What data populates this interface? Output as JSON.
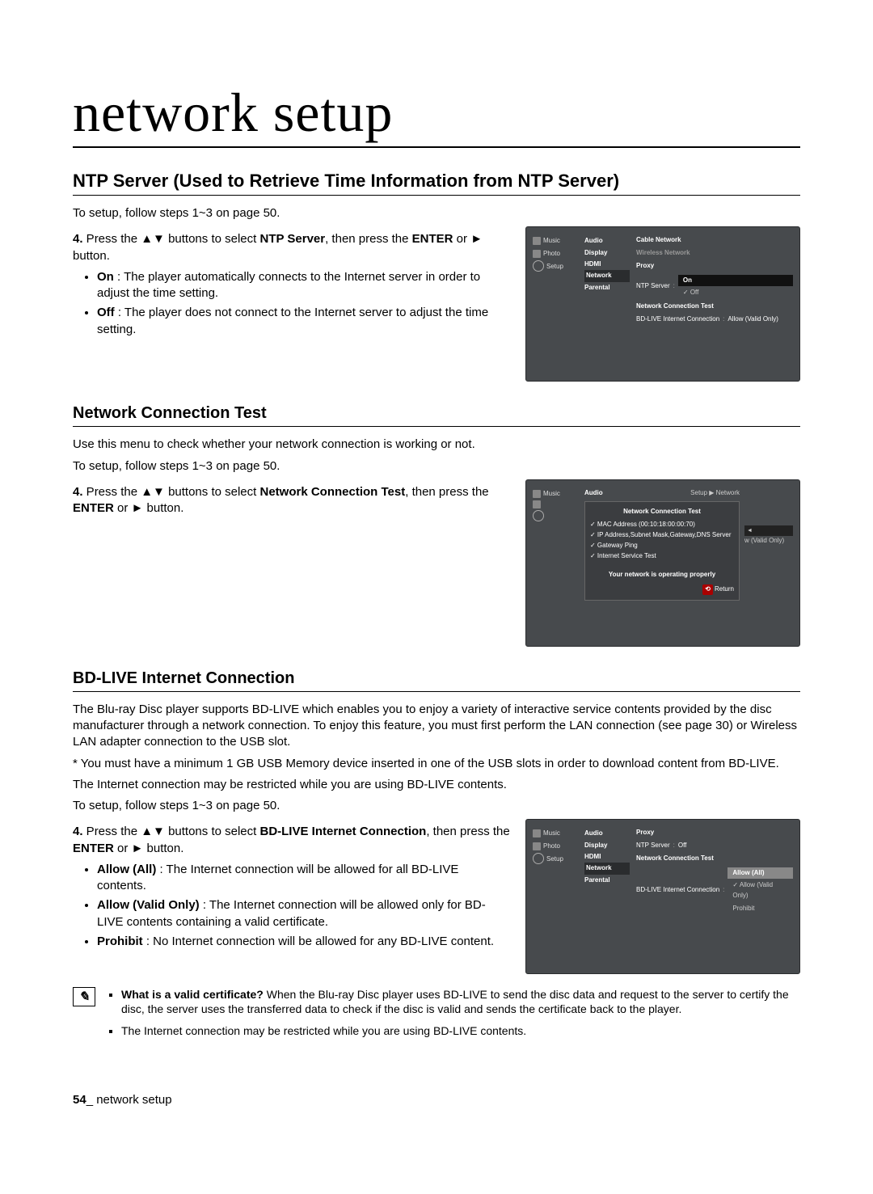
{
  "page_title": "network setup",
  "section_ntp": {
    "heading": "NTP Server (Used to Retrieve Time Information from NTP Server)",
    "intro": "To setup, follow steps 1~3 on page 50.",
    "step4_a": "4.",
    "step4_b": " Press the ▲▼ buttons to select ",
    "step4_bold": "NTP Server",
    "step4_c": ", then press the ",
    "enter": "ENTER",
    "step4_d": " or ► button.",
    "on_b": "On",
    "on_t": " : The player automatically connects to the Internet server in order to adjust the time setting.",
    "off_b": "Off",
    "off_t": " : The player does not connect to the Internet server to adjust the time setting.",
    "osd": {
      "left": [
        "Music",
        "Photo",
        "Setup"
      ],
      "mid": [
        "Audio",
        "Display",
        "HDMI",
        "Network",
        "Parental"
      ],
      "right_rows": [
        {
          "lbl": "Cable Network",
          "val": ""
        },
        {
          "lbl": "Wireless Network",
          "val": ""
        },
        {
          "lbl": "Proxy",
          "val": ""
        }
      ],
      "ntp_label": "NTP Server",
      "opt_on": "On",
      "opt_off": "Off",
      "nct": "Network Connection Test",
      "bdlive": "BD-LIVE Internet Connection",
      "allow": "Allow (Valid Only)"
    }
  },
  "section_nct": {
    "heading": "Network Connection Test",
    "p1": "Use this menu to check whether your network connection is working or not.",
    "p2": "To setup, follow steps 1~3 on page 50.",
    "step4_a": "4.",
    "step4_b": " Press the ▲▼ buttons to select ",
    "step4_bold": "Network Connection Test",
    "step4_c": ", then press the ",
    "enter": "ENTER",
    "step4_d": " or ► button.",
    "osd": {
      "left_music": "Music",
      "mid_audio": "Audio",
      "corner": "Setup ▶ Network",
      "panel_title": "Network Connection Test",
      "mac": "✓ MAC Address (00:10:18:00:00:70)",
      "ip": "✓ IP Address,Subnet Mask,Gateway,DNS Server",
      "gateway": "✓ Gateway Ping",
      "internet": "✓ Internet Service Test",
      "msg": "Your network is operating properly",
      "return": "Return",
      "sideval": "w (Valid Only)"
    }
  },
  "section_bd": {
    "heading": "BD-LIVE Internet Connection",
    "p1": "The Blu-ray Disc player supports BD-LIVE which enables you to enjoy a variety of interactive service contents provided by the disc manufacturer through a network connection. To enjoy this feature, you must first perform the LAN connection (see page 30) or Wireless LAN adapter connection to the USB slot.",
    "p2": "* You must have a minimum 1 GB USB Memory device inserted in one of the USB slots in order to download content from BD-LIVE.",
    "p3": "The Internet connection may be restricted while you are using BD-LIVE contents.",
    "p4": "To setup, follow steps 1~3 on page 50.",
    "step4_a": "4.",
    "step4_b": " Press the ▲▼ buttons to select ",
    "step4_bold": "BD-LIVE Internet Connection",
    "step4_c": ", then press the ",
    "enter": "ENTER",
    "step4_d": " or ► button.",
    "allow_all_b": "Allow (All)",
    "allow_all_t": " : The Internet connection will be allowed for all BD-LIVE contents.",
    "allow_valid_b": "Allow (Valid Only)",
    "allow_valid_t": " : The Internet connection will be allowed only for BD-LIVE contents containing a valid certificate.",
    "prohibit_b": "Prohibit",
    "prohibit_t": " : No Internet connection will be allowed for any BD-LIVE content.",
    "osd": {
      "left": [
        "Music",
        "Photo",
        "Setup"
      ],
      "mid": [
        "Audio",
        "Display",
        "HDMI",
        "Network",
        "Parental"
      ],
      "rows": [
        {
          "lbl": "Proxy",
          "val": ""
        },
        {
          "lbl": "NTP Server",
          "val": "Off"
        },
        {
          "lbl": "Network Connection Test",
          "val": ""
        }
      ],
      "bd_label": "BD-LIVE Internet Connection",
      "opt1": "Allow (All)",
      "opt2": "Allow (Valid Only)",
      "opt3": "Prohibit"
    }
  },
  "note": {
    "q_b": "What is a valid certificate?",
    "q_t": " When the Blu-ray Disc player uses BD-LIVE to send the disc data and request to the server to certify the disc, the server uses the transferred data to check if the disc is valid and sends the certificate back to the player.",
    "n2": "The Internet connection may be restricted while you are using BD-LIVE contents."
  },
  "footer": {
    "num": "54",
    "sep": "_ ",
    "label": "network setup"
  }
}
